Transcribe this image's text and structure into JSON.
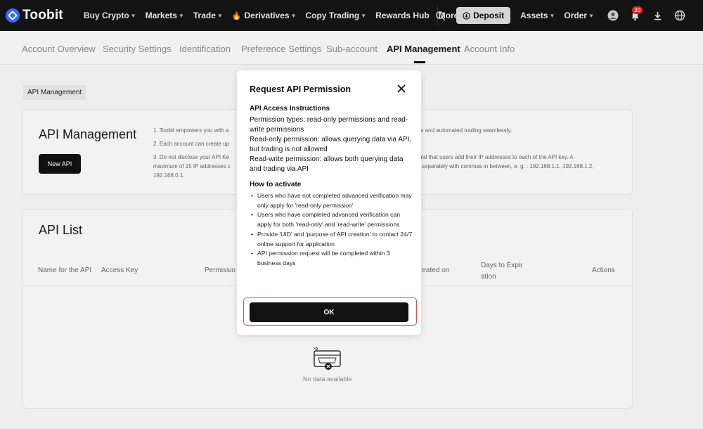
{
  "brand": {
    "name": "Toobit"
  },
  "topnav": {
    "items": [
      {
        "label": "Buy Crypto",
        "caret": true
      },
      {
        "label": "Markets",
        "caret": true
      },
      {
        "label": "Trade",
        "caret": true
      },
      {
        "label": "Derivatives",
        "caret": true,
        "flame": true
      },
      {
        "label": "Copy Trading",
        "caret": true
      },
      {
        "label": "Rewards Hub",
        "caret": false
      },
      {
        "label": "More",
        "caret": true
      }
    ],
    "deposit_label": "Deposit",
    "assets_label": "Assets",
    "order_label": "Order",
    "notification_count": "30"
  },
  "subnav": {
    "tabs": [
      "Account Overview",
      "Security Settings",
      "Identification",
      "Preference Settings",
      "Sub-account",
      "API Management",
      "Account Info"
    ],
    "active_index": 5
  },
  "breadcrumb": "API Management",
  "management": {
    "title": "API Management",
    "new_api_label": "New API",
    "notes": {
      "n1_left": "1. Toobit empowers you with a",
      "n1_right": "es and automated trading seamlessly.",
      "n2_left": "2. Each account can create up",
      "n3_left": "3. Do not disclose your API Ke",
      "n3_right": "end that users add their IP addresses to each of the API key. A",
      "n4_left": "maximum of 15 IP addresses c",
      "n4_right": "separately with commas in between, e. g. :  192.168.1.1, 192.168.1.2,",
      "n5_left": "192.168.0.1."
    }
  },
  "api_list": {
    "title": "API List",
    "columns": {
      "name": "Name for the API",
      "access_key": "Access Key",
      "permission": "Permissio",
      "created": "reated on",
      "expiration": "Days to Expir ation",
      "actions": "Actions"
    },
    "empty_text": "No data available"
  },
  "modal": {
    "title": "Request API Permission",
    "instructions_heading": "API Access Instructions",
    "instructions": [
      "Permission types: read-only permissions and read-write permissions",
      "Read-only permission: allows querying data via API, but trading is not allowed",
      "Read-write permission: allows both querying data and trading via API"
    ],
    "activate_heading": "How to activate",
    "steps": [
      "Users who have not completed advanced verification may only apply for 'read-only permission'",
      "Users who have completed advanced verification can apply for both 'read-only' and 'read-write' permissions",
      "Provide 'UID' and 'purpose of API creation' to contact 24/7 online support for application",
      "API permission request will be completed within 3 business days"
    ],
    "ok_label": "OK"
  },
  "colors": {
    "accent": "#121212",
    "brand_blue": "#3d6bff",
    "highlight_red": "#e05050"
  }
}
